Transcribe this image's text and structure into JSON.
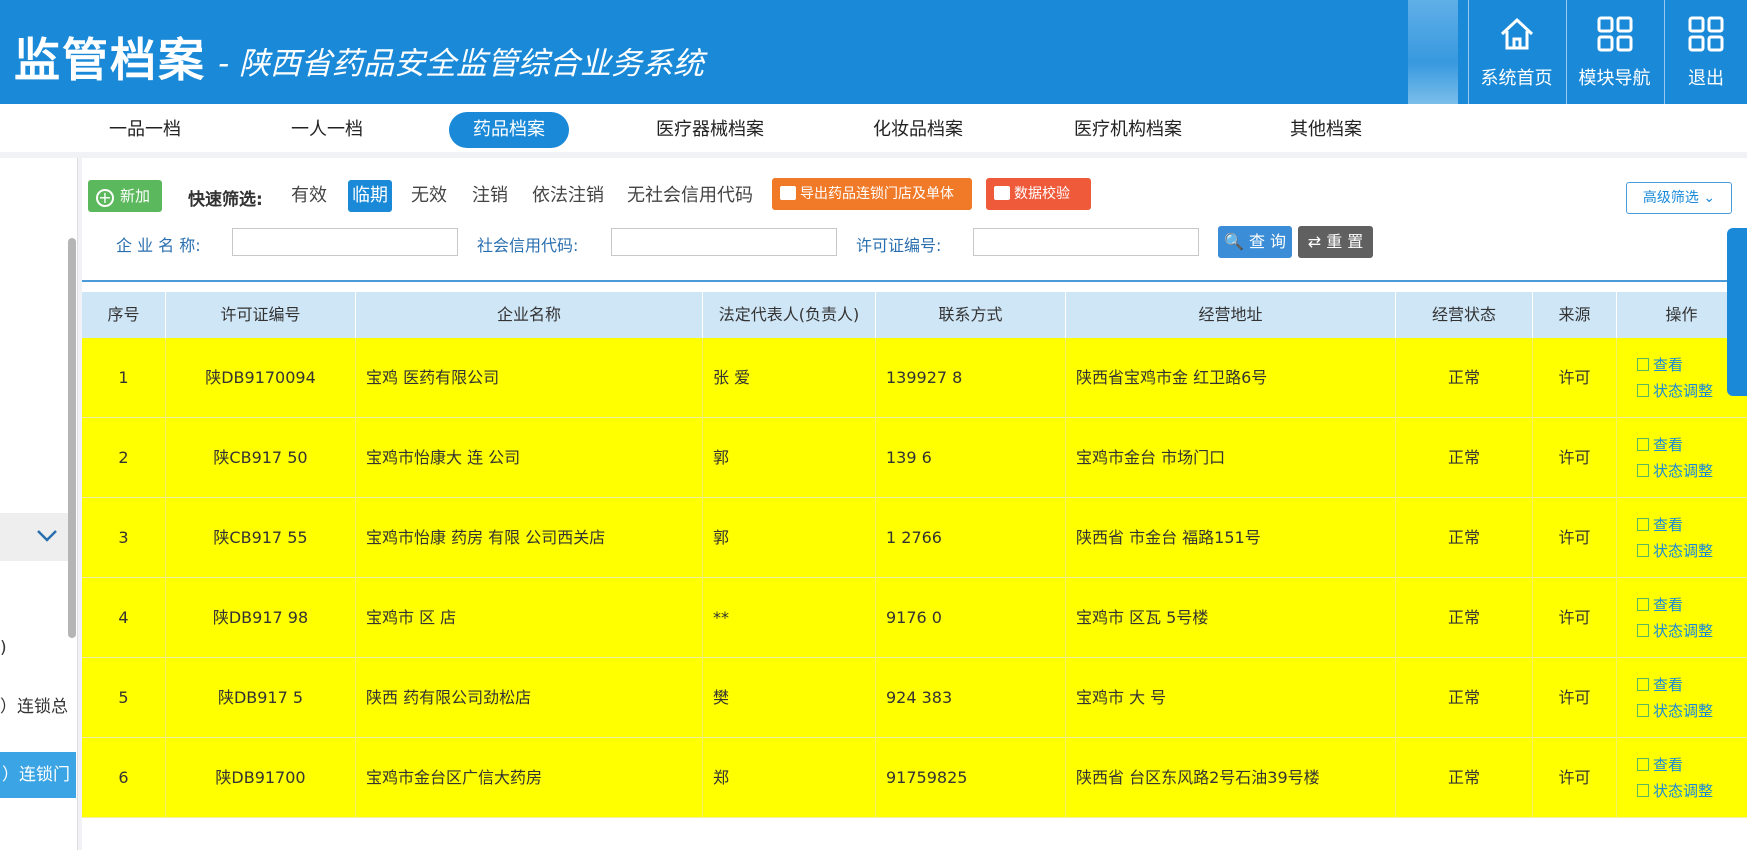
{
  "header": {
    "logo": "监管档案",
    "title": "- 陕西省药品安全监管综合业务系统",
    "nav": [
      {
        "label": "系统首页",
        "icon": "home-icon"
      },
      {
        "label": "模块导航",
        "icon": "grid-icon"
      },
      {
        "label": "退出",
        "icon": "grid-icon"
      }
    ]
  },
  "tabs": [
    {
      "label": "一品一档",
      "active": false
    },
    {
      "label": "一人一档",
      "active": false
    },
    {
      "label": "药品档案",
      "active": true
    },
    {
      "label": "医疗器械档案",
      "active": false
    },
    {
      "label": "化妆品档案",
      "active": false
    },
    {
      "label": "医疗机构档案",
      "active": false
    },
    {
      "label": "其他档案",
      "active": false
    }
  ],
  "sidebar": {
    "items": [
      ")",
      "）连锁总",
      "）连锁门"
    ]
  },
  "toolbar": {
    "add_label": "新加",
    "quick_filter_label": "快速筛选:",
    "quick_filters": [
      "有效",
      "临期",
      "无效",
      "注销",
      "依法注销",
      "无社会信用代码"
    ],
    "active_filter": "临期",
    "export_label": "导出药品连锁门店及单体",
    "validate_label": "数据校验",
    "advanced_label": "高级筛选 ⌄"
  },
  "filters": {
    "company_label": "企 业 名 称:",
    "credit_label": "社会信用代码:",
    "license_label": "许可证编号:",
    "search_label": "查 询",
    "reset_label": "重 置"
  },
  "table": {
    "headers": [
      "序号",
      "许可证编号",
      "企业名称",
      "法定代表人(负责人)",
      "联系方式",
      "经营地址",
      "经营状态",
      "来源",
      "操作"
    ],
    "rows": [
      {
        "no": "1",
        "license": "陕DB9170094",
        "company": "宝鸡   医药有限公司",
        "person": "张  爱",
        "phone": "139927  8",
        "address": "陕西省宝鸡市金   红卫路6号",
        "status": "正常",
        "source": "许可"
      },
      {
        "no": "2",
        "license": "陕CB917  50",
        "company": "宝鸡市怡康大  连    公司",
        "person": "郭",
        "phone": "139   6",
        "address": "宝鸡市金台   市场门口",
        "status": "正常",
        "source": "许可"
      },
      {
        "no": "3",
        "license": "陕CB917  55",
        "company": "宝鸡市怡康  药房  有限  公司西关店",
        "person": "郭",
        "phone": "1  2766",
        "address": "陕西省  市金台   福路151号",
        "status": "正常",
        "source": "许可"
      },
      {
        "no": "4",
        "license": "陕DB917  98",
        "company": "宝鸡市  区    店",
        "person": "**",
        "phone": "  9176   0",
        "address": "宝鸡市  区瓦  5号楼",
        "status": "正常",
        "source": "许可"
      },
      {
        "no": "5",
        "license": "陕DB917  5",
        "company": "陕西   药有限公司劲松店",
        "person": "樊",
        "phone": "  924  383",
        "address": "宝鸡市   大   号",
        "status": "正常",
        "source": "许可"
      },
      {
        "no": "6",
        "license": "陕DB91700",
        "company": "宝鸡市金台区广信大药房",
        "person": "郑",
        "phone": "  91759825",
        "address": "陕西省   台区东风路2号石油39号楼",
        "status": "正常",
        "source": "许可"
      }
    ],
    "ops": {
      "view": "查看",
      "adjust": "状态调整"
    }
  },
  "colors": {
    "header": "#1a8ad8",
    "row_highlight": "#ffff00",
    "add": "#5cb85c",
    "export": "#f07a28"
  }
}
